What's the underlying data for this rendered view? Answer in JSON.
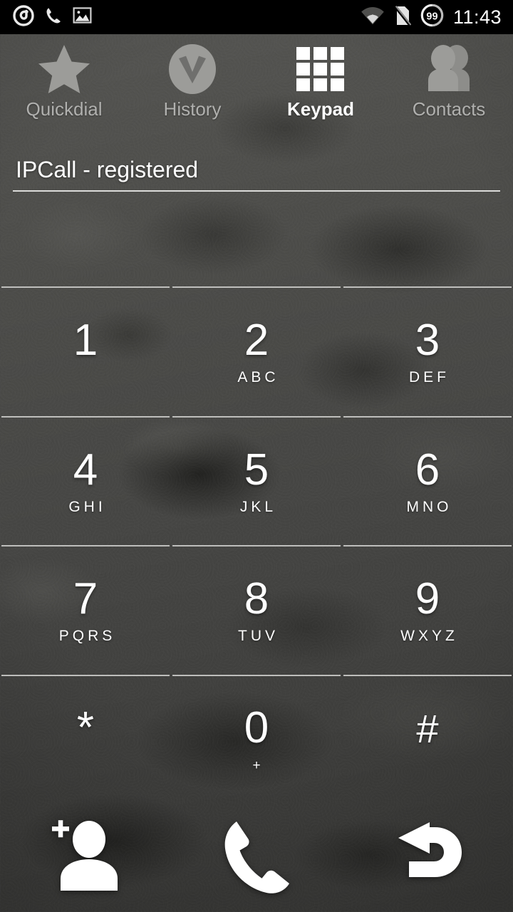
{
  "statusbar": {
    "time": "11:43",
    "battery_level": "99",
    "left_icons": [
      {
        "name": "app-swirl-icon",
        "label": "swirl-app"
      },
      {
        "name": "phone-call-icon",
        "label": "missed-call"
      },
      {
        "name": "image-icon",
        "label": "screenshot"
      }
    ],
    "right_icons": [
      {
        "name": "wifi-icon",
        "label": "wifi"
      },
      {
        "name": "sim-disabled-icon",
        "label": "no-sim"
      },
      {
        "name": "battery-circle-icon",
        "label": "battery"
      }
    ]
  },
  "tabs": [
    {
      "label": "Quickdial",
      "icon": "star-icon",
      "active": false
    },
    {
      "label": "History",
      "icon": "history-clock-icon",
      "active": false
    },
    {
      "label": "Keypad",
      "icon": "keypad-grid-icon",
      "active": true
    },
    {
      "label": "Contacts",
      "icon": "contacts-people-icon",
      "active": false
    }
  ],
  "account": {
    "status_text": "IPCall - registered",
    "account_name": "IPCall",
    "registration_state": "registered"
  },
  "dial_input": {
    "value": "",
    "placeholder": ""
  },
  "keypad": [
    {
      "digit": "1",
      "sub": ""
    },
    {
      "digit": "2",
      "sub": "ABC"
    },
    {
      "digit": "3",
      "sub": "DEF"
    },
    {
      "digit": "4",
      "sub": "GHI"
    },
    {
      "digit": "5",
      "sub": "JKL"
    },
    {
      "digit": "6",
      "sub": "MNO"
    },
    {
      "digit": "7",
      "sub": "PQRS"
    },
    {
      "digit": "8",
      "sub": "TUV"
    },
    {
      "digit": "9",
      "sub": "WXYZ"
    },
    {
      "digit": "*",
      "sub": ""
    },
    {
      "digit": "0",
      "sub": "+"
    },
    {
      "digit": "#",
      "sub": ""
    }
  ],
  "actions": [
    {
      "name": "add-contact-button",
      "label": "Add contact",
      "icon": "person-add-icon"
    },
    {
      "name": "call-button",
      "label": "Call",
      "icon": "phone-handset-icon"
    },
    {
      "name": "backspace-button",
      "label": "Delete",
      "icon": "backspace-arrow-icon"
    }
  ],
  "colors": {
    "accent_active": "#ffffff",
    "tab_inactive": "#b0b0ae",
    "divider": "#cfcfcd",
    "statusbar_bg": "#000000",
    "wallpaper_base": "#4b4b49"
  }
}
